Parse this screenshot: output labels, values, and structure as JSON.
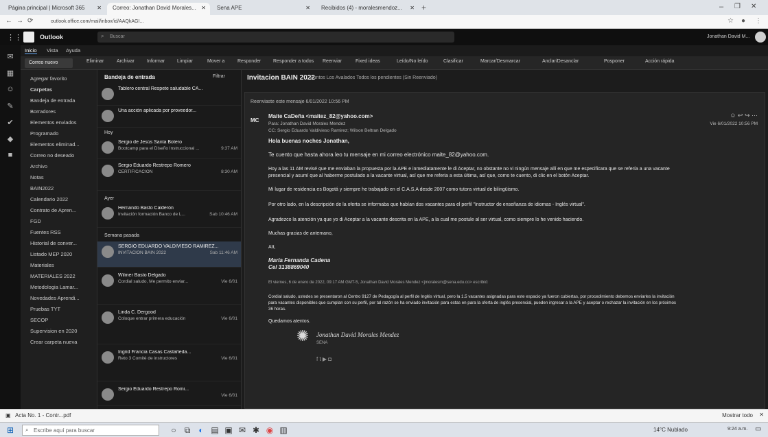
{
  "browser": {
    "tabs": [
      {
        "label": "Página principal | Microsoft 365",
        "active": false
      },
      {
        "label": "Correo: Jonathan David Morales...",
        "active": true
      },
      {
        "label": "Sena APE",
        "active": false
      },
      {
        "label": "Recibidos (4) - moralesmendoz...",
        "active": false
      }
    ],
    "url": "outlook.office.com/mail/inbox/id/AAQkAGI...",
    "window_min": "–",
    "window_max": "❐",
    "window_close": "✕"
  },
  "suite": {
    "app_name": "Outlook",
    "search_placeholder": "Buscar",
    "user": "Jonathan David M..."
  },
  "ribbon": {
    "tabs": [
      "Inicio",
      "Vista",
      "Ayuda"
    ],
    "new_mail": "Correo nuevo",
    "actions": [
      "Eliminar",
      "Archivar",
      "Informar",
      "Limpiar",
      "Mover a",
      "Responder",
      "Responder a todos",
      "Reenviar",
      "Fixed ideas",
      "Leído/No leído",
      "Clasificar",
      "Marcar/Desmarcar",
      "Anclar/Desanclar",
      "Posponer",
      "Acción rápida"
    ]
  },
  "folders": {
    "items": [
      "Agregar favorito",
      "Carpetas",
      "Bandeja de entrada",
      "Borradores",
      "Elementos enviados",
      "Programado",
      "Elementos eliminad...",
      "Correo no deseado",
      "Archivo",
      "Notas",
      "BAIN2022",
      "Calendario 2022",
      "Contrato de Apren...",
      "FGD",
      "Fuentes RSS",
      "Historial de conver...",
      "Listado MEP 2020",
      "Materiales",
      "MATERIALES 2022",
      "Metodologia Lamar...",
      "Novedades Aprendi...",
      "Pruebas TYT",
      "SECOP",
      "Supervision en 2020",
      "Crear carpeta nueva"
    ]
  },
  "msglist": {
    "header": "Bandeja de entrada",
    "filter": "Filtrar",
    "groups": [
      "Hoy",
      "Ayer",
      "Semana pasada"
    ],
    "messages": [
      {
        "sender": "Tablero central Respete saludable CA...",
        "subject": "",
        "time": ""
      },
      {
        "sender": "Una acción aplicada por proveedor...",
        "subject": "",
        "time": ""
      },
      {
        "sender": "Sergio de Jesús Santa Botero",
        "subject": "Bootcamp para el Diseño Instruccional ...",
        "time": "9:37 AM"
      },
      {
        "sender": "Sergio Eduardo Restrepo Romero",
        "subject": "CERTIFICACIÓN",
        "time": "8:30 AM"
      },
      {
        "sender": "Hernando Basto Calderón",
        "subject": "Invitación formación Banco de L...",
        "time": "Sab 10:46 AM"
      },
      {
        "sender": "SERGIO EDUARDO VALDIVIESO RAMIREZ...",
        "subject": "INVITACION BAIN 2022",
        "time": "Sab 11:46 AM"
      },
      {
        "sender": "Wilmer Basto Delgado",
        "subject": "Cordial saludo, Me permito enviar...",
        "time": "Vie 6/01"
      },
      {
        "sender": "Linda C. Dergood",
        "subject": "Coloque entrar primera educación",
        "time": "Vie 6/01"
      },
      {
        "sender": "Ingrid Francia Casas Castañeda...",
        "subject": "Reto 3 Comité de instructores",
        "time": "Vie 6/01"
      },
      {
        "sender": "Sergio Eduardo Restrepo Romi...",
        "subject": "",
        "time": "Vie 6/01"
      }
    ]
  },
  "reading": {
    "title": "Invitacion BAIN 2022",
    "subtitle": "Puntos Los Avalados Todos los pendientes (Sin Reenviado)",
    "forwarded": "Reenviaste este mensaje 6/01/2022 10:56 PM",
    "from": "Maite CaDeña <maitez_82@yahoo.com>",
    "to": "Para: Jonathan David Morales Mendez",
    "cc": "CC: Sergio Eduardo Valdivieso Ramirez; Wilson Beltran Delgado",
    "date": "Vie 6/01/2022 10:56 PM",
    "greeting": "Hola buenas noches Jonathan,",
    "p1": "Te cuento que hasta ahora leo tu mensaje en mi correo electrónico maite_82@yahoo.com.",
    "p2": "Hoy a las 11 AM revisé que me enviaban la propuesta por la APE e inmediatamente le di Aceptar, no obstante no vi ningún mensaje allí en que me especificara que se refería a una vacante",
    "p2b": "presencial y asumí que al haberme postulado a la vacante virtual, así que me referia a esta última, así que, como te cuento, di clic en el botón Aceptar.",
    "p3": "Mi lugar de residencia es Bogotá y siempre he trabajado en el C.A.S.A desde 2007 como tutora virtual de bilingüismo.",
    "p4": "Por otro lado, en la descripción de la oferta se informaba que habían dos vacantes para el perfil \"Instructor de enseñanza de idiomas - Inglés virtual\".",
    "p5": "Agradezco la atención ya que yo di Aceptar a la vacante descrita en la APE, a la cual me postule al ser virtual, como siempre lo he venido haciendo.",
    "p6": "Muchas gracias de antemano,",
    "sig1": "Att,",
    "sig2": "María Fernanda Cadena",
    "sig3": "Cel 3138869040",
    "quoted_header": "El viernes, 6 de enero de 2022, 09:17 AM GMT-5, Jonathan David Morales Mendez <jmoralesm@sena.edu.co> escribió:",
    "q1": "Cordial saludo, ustedes se presentaron al Centro 9127 de Pedagogía al perfil de Inglés virtual, pero la 1.5 vacantes asignadas para este espacio ya fueron cubiertas, por procedimiento debemos enviarles la invitación",
    "q2": "para vacantes disponibles que cumplan con su perfil, por tal razón se ha enviado invitación para estas en para la oferta de inglés presencial, pueden ingresar a la APE y aceptar o rechazar la invitación en los próximos",
    "q3": "36 horas.",
    "q4": "Quedamos atentos.",
    "sig_name": "Jonathan David Morales Mendez",
    "sig_org": "SENA"
  },
  "downloads": {
    "file": "Acta No. 1 - Contr...pdf",
    "show_all": "Mostrar todo"
  },
  "taskbar": {
    "search": "Escribe aquí para buscar",
    "weather": "14°C Nublado",
    "time": "9:24 a.m."
  }
}
